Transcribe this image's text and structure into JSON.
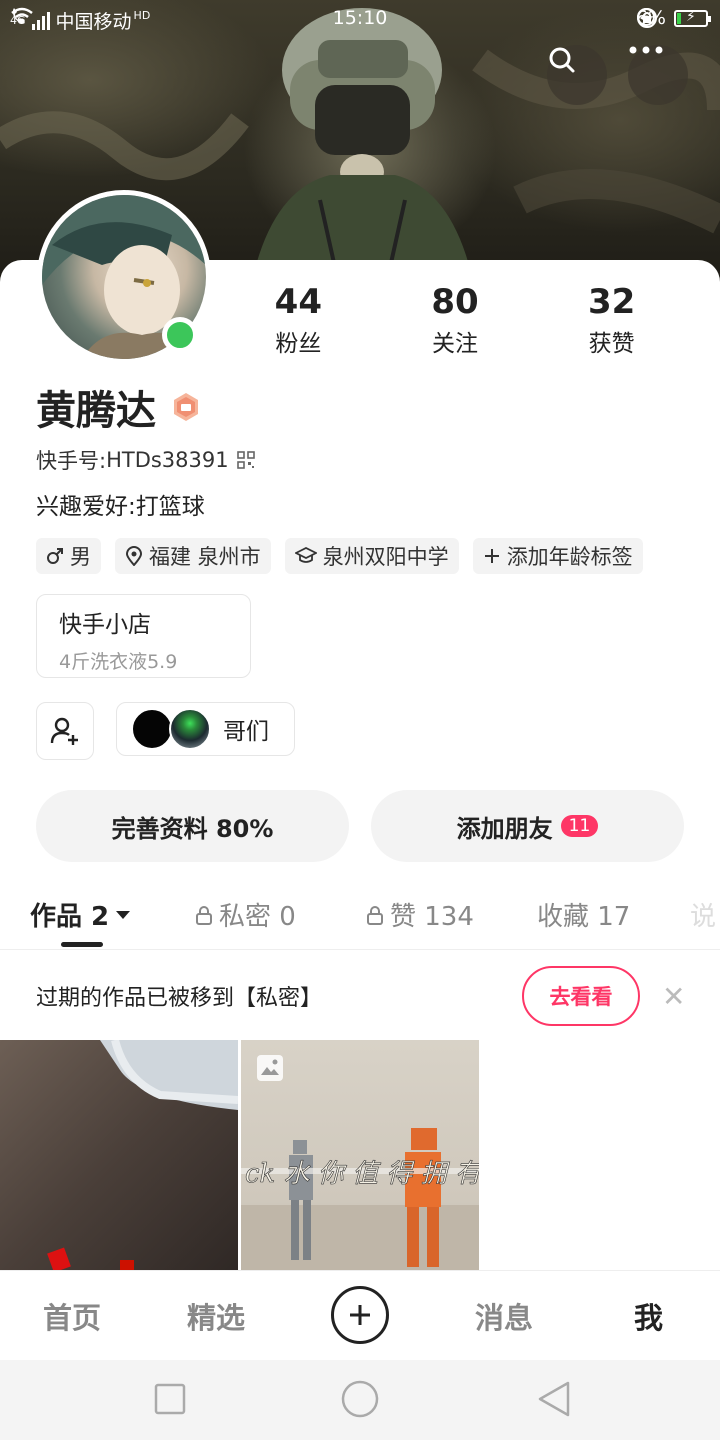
{
  "status_bar": {
    "network": "4G",
    "carrier": "中国移动",
    "hd": "HD",
    "time": "15:10",
    "battery_pct": "6%"
  },
  "profile": {
    "name": "黄腾达",
    "kuaishou_id_label": "快手号:",
    "kuaishou_id": "HTDs38391",
    "hobby": "兴趣爱好:打篮球",
    "stats": [
      {
        "num": "44",
        "label": "粉丝"
      },
      {
        "num": "80",
        "label": "关注"
      },
      {
        "num": "32",
        "label": "获赞"
      }
    ],
    "tags": [
      {
        "icon": "male-icon",
        "text": "男"
      },
      {
        "icon": "location-icon",
        "text": "福建 泉州市"
      },
      {
        "icon": "school-icon",
        "text": "泉州双阳中学"
      },
      {
        "icon": "plus-icon",
        "text": "添加年龄标签"
      }
    ]
  },
  "shop": {
    "title": "快手小店",
    "subtitle": "4斤洗衣液5.9"
  },
  "group": {
    "label": "哥们"
  },
  "actions": {
    "complete_profile": "完善资料 80%",
    "add_friends": "添加朋友",
    "add_friends_count": "11"
  },
  "tabs": [
    {
      "label": "作品 2",
      "active": true
    },
    {
      "label": "私密 0",
      "locked": true
    },
    {
      "label": "赞 134",
      "locked": true
    },
    {
      "label": "收藏 17"
    },
    {
      "label": "说"
    }
  ],
  "notice": {
    "text": "过期的作品已被移到【私密】",
    "button": "去看看"
  },
  "thumb2_caption": "ck 水 你 值 得 拥 有",
  "bottom_nav": {
    "home": "首页",
    "featured": "精选",
    "messages": "消息",
    "me": "我"
  },
  "colors": {
    "accent": "#fe3666",
    "online": "#3cc65a"
  }
}
